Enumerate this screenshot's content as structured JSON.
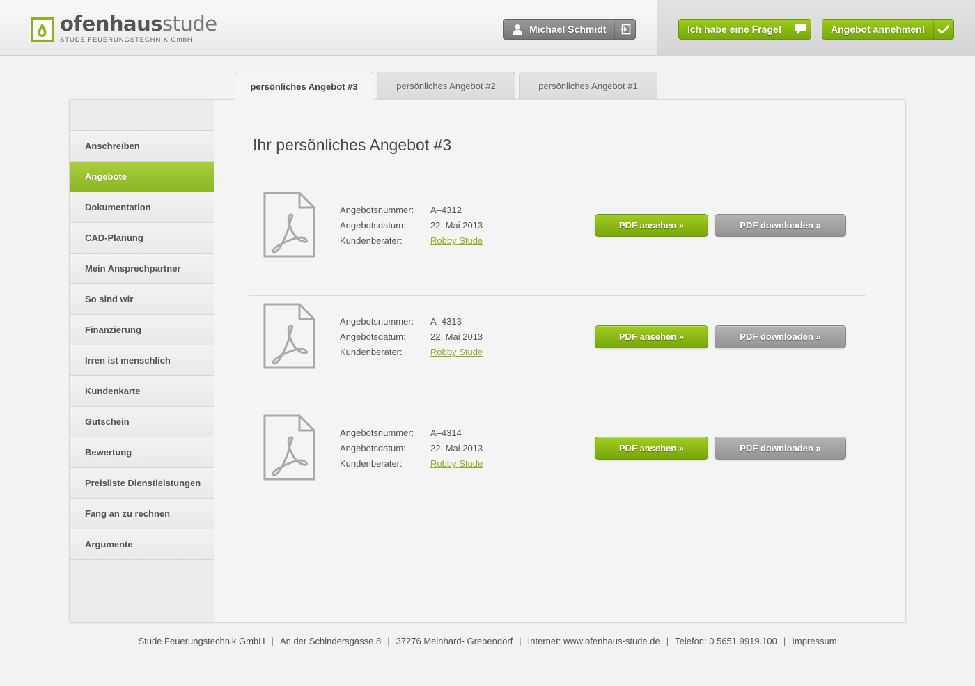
{
  "brand": {
    "name_bold": "ofenhaus",
    "name_light": "stude",
    "tagline": "STUDE FEUERUNGSTECHNIK GmbH"
  },
  "header": {
    "user_name": "Michael Schmidt",
    "question_label": "Ich habe eine Frage!",
    "accept_label": "Angebot annehmen!"
  },
  "tabs": [
    {
      "label": "persönliches Angebot #3",
      "active": true
    },
    {
      "label": "persönliches Angebot #2",
      "active": false
    },
    {
      "label": "persönliches Angebot #1",
      "active": false
    }
  ],
  "sidebar": {
    "items": [
      {
        "label": "Anschreiben"
      },
      {
        "label": "Angebote",
        "active": true
      },
      {
        "label": "Dokumentation"
      },
      {
        "label": "CAD-Planung"
      },
      {
        "label": "Mein Ansprechpartner"
      },
      {
        "label": "So sind wir"
      },
      {
        "label": "Finanzierung"
      },
      {
        "label": "Irren ist menschlich"
      },
      {
        "label": "Kundenkarte"
      },
      {
        "label": "Gutschein"
      },
      {
        "label": "Bewertung"
      },
      {
        "label": "Preisliste Dienstleistungen"
      },
      {
        "label": "Fang an zu rechnen"
      },
      {
        "label": "Argumente"
      }
    ]
  },
  "main": {
    "title": "Ihr persönliches Angebot #3",
    "labels": {
      "number": "Angebotsnummer:",
      "date": "Angebotsdatum:",
      "advisor": "Kundenberater:"
    },
    "view_label": "PDF ansehen »",
    "download_label": "PDF downloaden »",
    "offers": [
      {
        "number": "A–4312",
        "date": "22. Mai 2013",
        "advisor": "Robby Stude"
      },
      {
        "number": "A–4313",
        "date": "22. Mai 2013",
        "advisor": "Robby Stude"
      },
      {
        "number": "A–4314",
        "date": "22. Mai 2013",
        "advisor": "Robby Stude"
      }
    ]
  },
  "footer": {
    "company": "Stude Feuerungstechnik GmbH",
    "street": "An der Schindersgasse 8",
    "city": "37276 Meinhard- Grebendorf",
    "web": "Internet: www.ofenhaus-stude.de",
    "phone": "Telefon: 0 5651.9919.100",
    "imprint": "Impressum"
  },
  "colors": {
    "accent_green": "#8cb624",
    "button_gray": "#939393",
    "link_green": "#8ab01e"
  },
  "icons": [
    "leaf-logo-icon",
    "user-icon",
    "logout-icon",
    "speech-bubble-icon",
    "checkmark-icon",
    "pdf-file-icon"
  ]
}
